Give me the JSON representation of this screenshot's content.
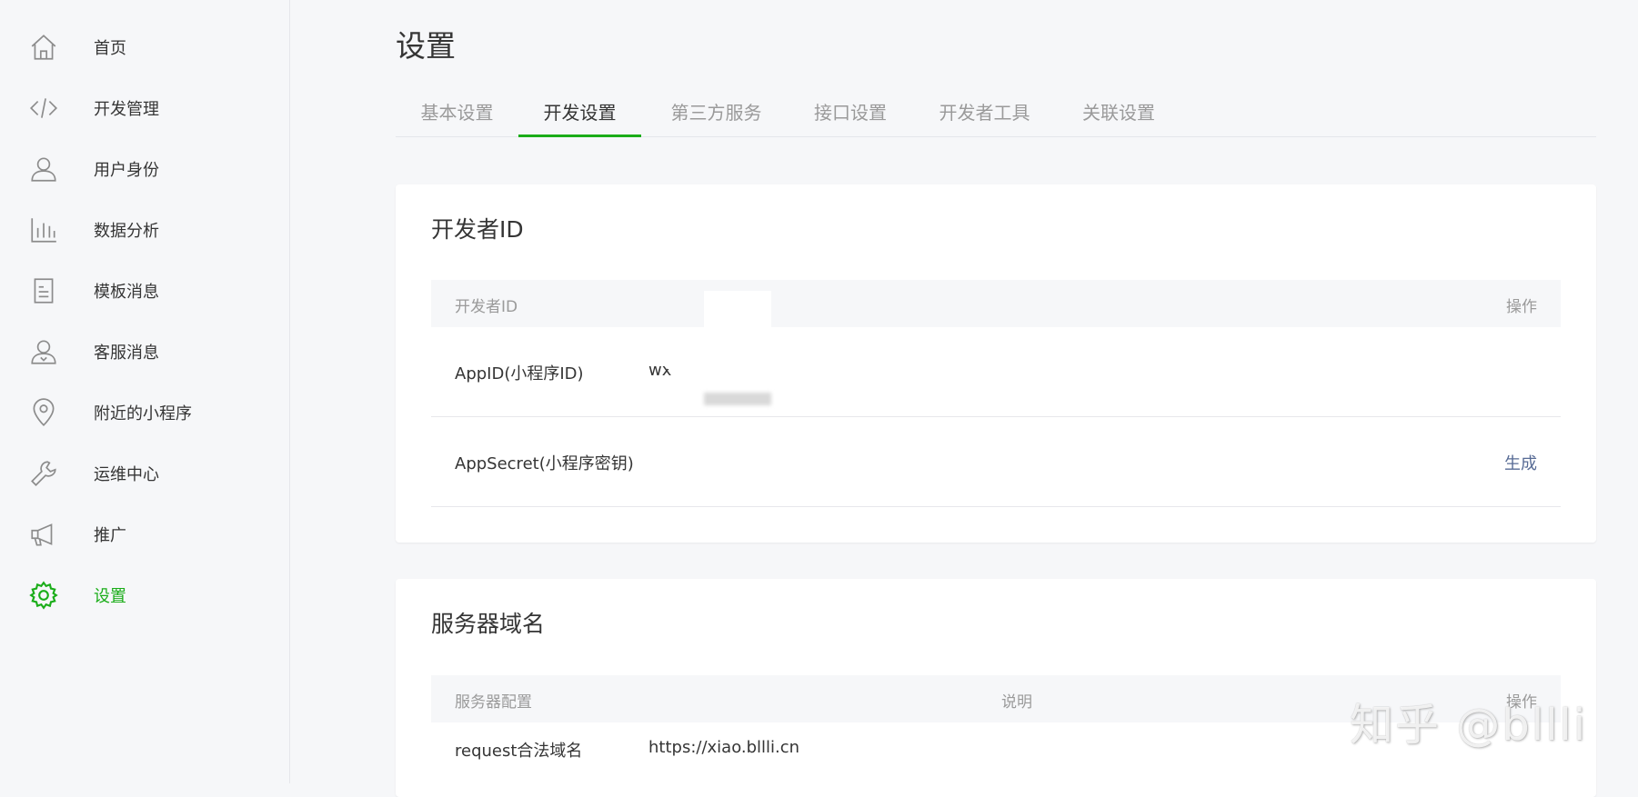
{
  "sidebar": {
    "items": [
      {
        "label": "首页",
        "icon": "home-icon"
      },
      {
        "label": "开发管理",
        "icon": "code-icon"
      },
      {
        "label": "用户身份",
        "icon": "user-icon"
      },
      {
        "label": "数据分析",
        "icon": "bar-chart-icon"
      },
      {
        "label": "模板消息",
        "icon": "document-icon"
      },
      {
        "label": "客服消息",
        "icon": "customer-service-icon"
      },
      {
        "label": "附近的小程序",
        "icon": "location-pin-icon"
      },
      {
        "label": "运维中心",
        "icon": "wrench-icon"
      },
      {
        "label": "推广",
        "icon": "megaphone-icon"
      },
      {
        "label": "设置",
        "icon": "gear-icon",
        "active": true
      }
    ]
  },
  "page": {
    "title": "设置"
  },
  "tabs": [
    {
      "label": "基本设置"
    },
    {
      "label": "开发设置",
      "active": true
    },
    {
      "label": "第三方服务"
    },
    {
      "label": "接口设置"
    },
    {
      "label": "开发者工具"
    },
    {
      "label": "关联设置"
    }
  ],
  "developer_card": {
    "title": "开发者ID",
    "header": {
      "col1": "开发者ID",
      "col2": "操作"
    },
    "rows": [
      {
        "label": "AppID(小程序ID)",
        "value": "wx",
        "action": ""
      },
      {
        "label": "AppSecret(小程序密钥)",
        "value": "",
        "action": "生成"
      }
    ]
  },
  "server_card": {
    "title": "服务器域名",
    "header": {
      "col1": "服务器配置",
      "col2": "说明",
      "col3": "操作"
    },
    "rows": [
      {
        "label": "request合法域名",
        "value": "https://xiao.bllli.cn"
      }
    ]
  },
  "watermark": "知乎 @bllli",
  "colors": {
    "accent": "#1aad19",
    "link": "#576b95",
    "muted_text": "#9a9a9a",
    "text": "#353535",
    "background": "#f6f7f9"
  }
}
